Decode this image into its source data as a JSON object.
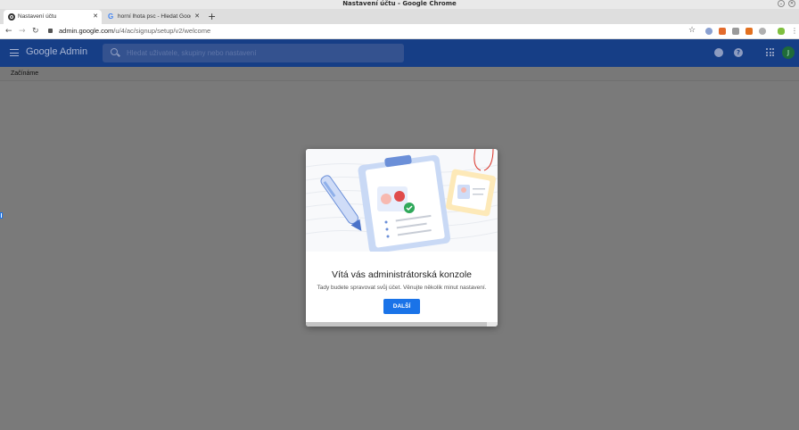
{
  "window": {
    "title": "Nastavení účtu - Google Chrome"
  },
  "tabs": [
    {
      "label": "Nastavení účtu",
      "active": true
    },
    {
      "label": "horní lhota psc - Hledat Googlem",
      "active": false
    }
  ],
  "address": {
    "host": "admin.google.com",
    "path": "/u/4/ac/signup/setup/v2/welcome"
  },
  "admin": {
    "brand": "Google Admin",
    "search_placeholder": "Hledat uživatele, skupiny nebo nastavení",
    "avatar_initial": "J"
  },
  "breadcrumb": "Začínáme",
  "dialog": {
    "title": "Vítá vás administrátorská konzole",
    "subtitle": "Tady budete spravovat svůj účet. Věnujte několik minut nastavení.",
    "next_label": "DALŠÍ"
  },
  "colors": {
    "admin_header": "#163e86",
    "primary_button": "#1a73e8",
    "overlay": "#7a7a7a"
  },
  "icons": [
    "close-icon",
    "back-icon",
    "forward-icon",
    "reload-icon",
    "lock-icon",
    "star-icon",
    "menu-icon",
    "search-icon",
    "notifications-icon",
    "help-icon",
    "apps-icon"
  ]
}
